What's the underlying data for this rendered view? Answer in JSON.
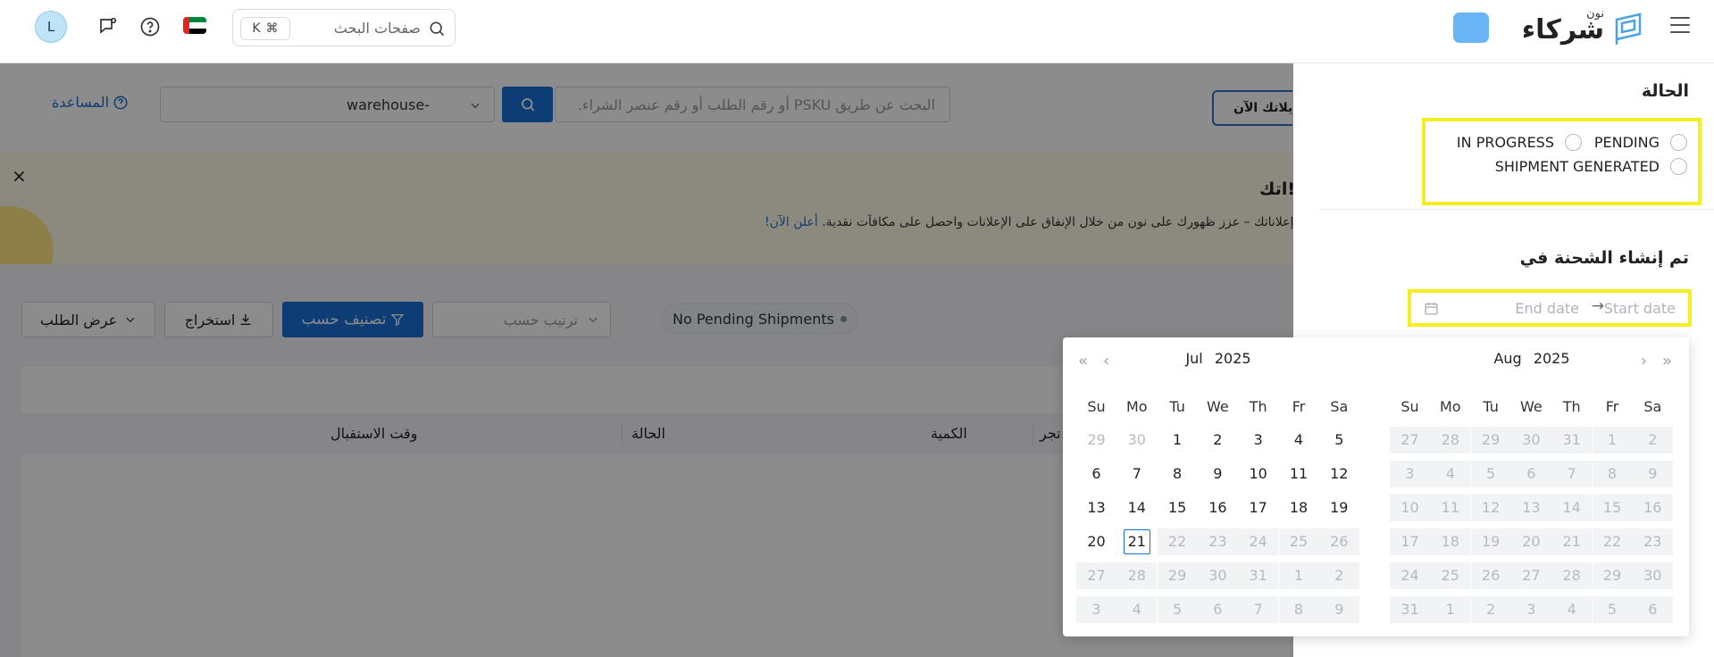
{
  "topbar": {
    "avatar_initial": "L",
    "search_placeholder": "صفحات البحث",
    "shortcut_cmd": "⌘",
    "shortcut_key": "K",
    "logo_small": "نون",
    "logo_main": "شركاء",
    "flag": "uae-flag"
  },
  "filters": {
    "help_label": "المساعدة",
    "warehouse_value": "warehouse-",
    "psku_placeholder": "البحث عن طريق PSKU أو رقم الطلب أو رقم عنصر الشراء.",
    "ads_button_label": "ويلاتك الآن"
  },
  "banner": {
    "title": "اتك!",
    "body": "إعلاناتك – عزز ظهورك على نون من خلال الإنفاق على الإعلانات واحصل على مكافآت نقدية.",
    "link": "أعلن الآن!",
    "close_symbol": "×"
  },
  "toolbar": {
    "pending_label": "No Pending Shipments",
    "sort_placeholder": "ترتيب حسب",
    "classify_label": "تصنيف حسب",
    "export_label": "استخراج",
    "view_label": "عرض الطلب"
  },
  "table": {
    "headers": [
      "تجر",
      "الكمية",
      "الحالة",
      "وقت الاستقبال"
    ]
  },
  "drawer": {
    "status_heading": "الحالة",
    "status_options": [
      "PENDING",
      "IN PROGRESS",
      "SHIPMENT GENERATED"
    ],
    "shipment_heading": "تم إنشاء الشحنة في",
    "start_placeholder": "Start date",
    "end_placeholder": "End date",
    "arrow": "→"
  },
  "calendar": {
    "weekdays": [
      "Su",
      "Mo",
      "Tu",
      "We",
      "Th",
      "Fr",
      "Sa"
    ],
    "today": 21,
    "months": [
      {
        "month": "Jul",
        "year": "2025",
        "days": [
          [
            29,
            30,
            1,
            2,
            3,
            4,
            5
          ],
          [
            6,
            7,
            8,
            9,
            10,
            11,
            12
          ],
          [
            13,
            14,
            15,
            16,
            17,
            18,
            19
          ],
          [
            20,
            21,
            22,
            23,
            24,
            25,
            26
          ],
          [
            27,
            28,
            29,
            30,
            31,
            1,
            2
          ],
          [
            3,
            4,
            5,
            6,
            7,
            8,
            9
          ]
        ]
      },
      {
        "month": "Aug",
        "year": "2025",
        "days": [
          [
            27,
            28,
            29,
            30,
            31,
            1,
            2
          ],
          [
            3,
            4,
            5,
            6,
            7,
            8,
            9
          ],
          [
            10,
            11,
            12,
            13,
            14,
            15,
            16
          ],
          [
            17,
            18,
            19,
            20,
            21,
            22,
            23
          ],
          [
            24,
            25,
            26,
            27,
            28,
            29,
            30
          ],
          [
            31,
            1,
            2,
            3,
            4,
            5,
            6
          ]
        ]
      }
    ]
  },
  "colors": {
    "accent": "#1a6fd6",
    "highlight": "#f5ee20",
    "banner_bg": "#fffbe6",
    "overlay": "rgba(0,0,0,0.45)"
  }
}
